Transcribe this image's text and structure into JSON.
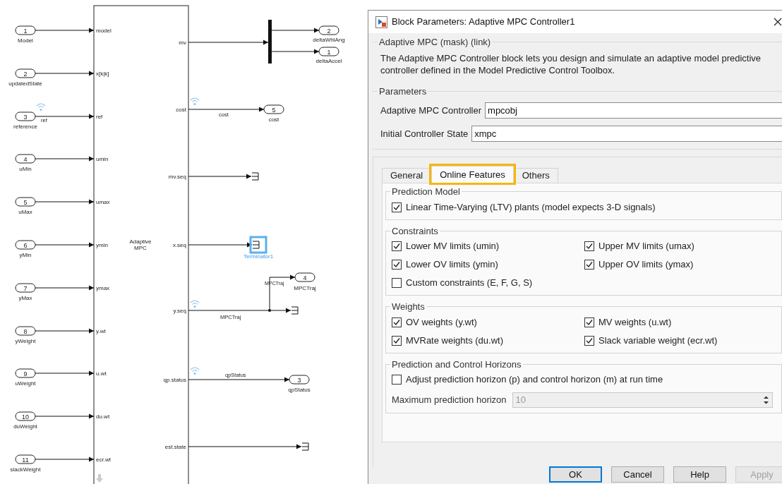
{
  "diagram": {
    "block_label": "Adaptive MPC",
    "inports": [
      {
        "number": "1",
        "name": "Model",
        "port": "model"
      },
      {
        "number": "2",
        "name": "updatedState",
        "port": "x[k|k]"
      },
      {
        "number": "3",
        "name": "reference",
        "port": "ref"
      },
      {
        "number": "4",
        "name": "uMin",
        "port": "umin"
      },
      {
        "number": "5",
        "name": "uMax",
        "port": "umax"
      },
      {
        "number": "6",
        "name": "yMin",
        "port": "ymin"
      },
      {
        "number": "7",
        "name": "yMax",
        "port": "ymax"
      },
      {
        "number": "8",
        "name": "yWeight",
        "port": "y.wt"
      },
      {
        "number": "9",
        "name": "uWeight",
        "port": "u.wt"
      },
      {
        "number": "10",
        "name": "duWeight",
        "port": "du.wt"
      },
      {
        "number": "11",
        "name": "slackWeight",
        "port": "ecr.wt"
      }
    ],
    "outputs": [
      "mv",
      "cost",
      "mv.seq",
      "x.seq",
      "y.seq",
      "qp.status",
      "est.state"
    ],
    "outports": [
      {
        "number": "2",
        "name": "deltaWhlAng"
      },
      {
        "number": "1",
        "name": "deltaAccel"
      },
      {
        "number": "5",
        "name": "cost"
      },
      {
        "number": "4",
        "name": "MPCTraj"
      },
      {
        "number": "3",
        "name": "qpStatus"
      }
    ],
    "signal_labels": [
      "ref",
      "cost",
      "MPCTraj",
      "MPCTraj",
      "qpStatus"
    ],
    "terminator": {
      "name": "Terminator1",
      "selected": true
    }
  },
  "dialog": {
    "title": "Block Parameters: Adaptive MPC Controller1",
    "mask_title": "Adaptive MPC (mask) (link)",
    "description": "The Adaptive MPC Controller block lets you design and simulate an adaptive model predictive controller defined in the Model Predictive Control Toolbox.",
    "parameters_title": "Parameters",
    "fields": [
      {
        "label": "Adaptive MPC Controller",
        "value": "mpcobj"
      },
      {
        "label": "Initial Controller State",
        "value": "xmpc"
      }
    ],
    "tabs": [
      {
        "label": "General",
        "selected": false,
        "highlighted": false
      },
      {
        "label": "Online Features",
        "selected": true,
        "highlighted": true
      },
      {
        "label": "Others",
        "selected": false,
        "highlighted": false
      }
    ],
    "groups": [
      {
        "title": "Prediction Model",
        "items": [
          {
            "kind": "checkbox",
            "label": "Linear Time-Varying (LTV) plants (model expects 3-D signals)",
            "checked": true
          }
        ]
      },
      {
        "title": "Constraints",
        "items": [
          {
            "kind": "checkbox",
            "label": "Lower MV limits (umin)",
            "checked": true
          },
          {
            "kind": "checkbox",
            "label": "Upper MV limits (umax)",
            "checked": true
          },
          {
            "kind": "checkbox",
            "label": "Lower OV limits (ymin)",
            "checked": true
          },
          {
            "kind": "checkbox",
            "label": "Upper OV limits (ymax)",
            "checked": true
          },
          {
            "kind": "checkbox",
            "label": "Custom constraints (E, F, G, S)",
            "checked": false
          }
        ]
      },
      {
        "title": "Weights",
        "items": [
          {
            "kind": "checkbox",
            "label": "OV weights (y.wt)",
            "checked": true
          },
          {
            "kind": "checkbox",
            "label": "MV weights (u.wt)",
            "checked": true
          },
          {
            "kind": "checkbox",
            "label": "MVRate weights (du.wt)",
            "checked": true
          },
          {
            "kind": "checkbox",
            "label": "Slack variable weight (ecr.wt)",
            "checked": true
          }
        ]
      },
      {
        "title": "Prediction and Control Horizons",
        "items": [
          {
            "kind": "checkbox",
            "label": "Adjust prediction horizon (p) and control horizon (m) at run time",
            "checked": false
          },
          {
            "kind": "spinner",
            "label": "Maximum prediction horizon",
            "value": "10",
            "disabled": true
          }
        ]
      }
    ],
    "buttons": [
      {
        "label": "OK",
        "default": true,
        "disabled": false
      },
      {
        "label": "Cancel",
        "default": false,
        "disabled": false
      },
      {
        "label": "Help",
        "default": false,
        "disabled": false
      },
      {
        "label": "Apply",
        "default": false,
        "disabled": true
      }
    ]
  }
}
